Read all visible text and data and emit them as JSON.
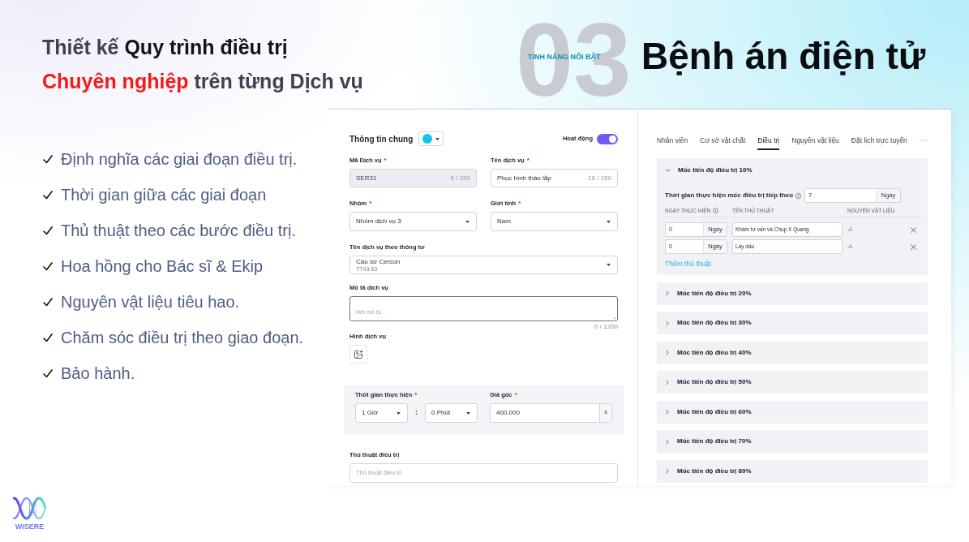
{
  "header": {
    "headline": [
      {
        "parts": [
          {
            "text": "Thiết kế ",
            "kind": "muted"
          },
          {
            "text": "Quy trình điều trị",
            "kind": "strong"
          }
        ]
      },
      {
        "parts": [
          {
            "text": "Chuyên nghiệp",
            "kind": "accent"
          },
          {
            "text": " trên từng Dịch vụ",
            "kind": "muted"
          }
        ]
      }
    ],
    "number": "03",
    "tag": "TÍNH NĂNG NỔI BẬT",
    "title": "Bệnh án điện tử"
  },
  "features": [
    "Định nghĩa các giai đoạn điều trị.",
    "Thời gian giữa các giai đoạn",
    "Thủ thuật theo các bước điều trị.",
    "Hoa hồng cho Bác sĩ & Ekip",
    "Nguyên vật liệu tiêu hao.",
    "Chăm sóc điều trị theo giao đoạn.",
    "Bảo hành."
  ],
  "brand": {
    "name": "WISERE"
  },
  "service_form": {
    "title": "Thông tin chung",
    "color_picker": {
      "color": "#14c4e8"
    },
    "status": {
      "label": "Hoạt động",
      "on": true
    },
    "field_rows": [
      [
        {
          "kind": "text",
          "label": "Mã Dịch vụ",
          "mark": "*",
          "value": "SER31",
          "counter": "5 / 150",
          "disabled": true
        },
        {
          "kind": "text",
          "label": "Tên dịch vụ",
          "mark": "*",
          "value": "Phục hình tháo lắp",
          "counter": "18 / 150",
          "disabled": false
        }
      ],
      [
        {
          "kind": "select",
          "label": "Nhóm",
          "mark": "*",
          "value": "Nhóm dịch vụ 3"
        },
        {
          "kind": "select",
          "label": "Giới tính",
          "mark": "*",
          "value": "Nam"
        }
      ],
      [
        {
          "kind": "select",
          "label": "Tên dịch vụ theo thông tư",
          "value": "Cầu sứ Cercon",
          "detail": "TT43-63"
        }
      ],
      [
        {
          "kind": "textarea",
          "label": "Mô tả dịch vụ",
          "placeholder": "Viết mô tả...",
          "counter": "0 / 1200",
          "focused": true
        }
      ],
      [
        {
          "kind": "image",
          "label": "Hình dịch vụ"
        }
      ]
    ],
    "timing": {
      "label": "Thời gian thực hiện",
      "mark": "*",
      "hours": "1 Giờ",
      "separator": ":",
      "minutes": "0 Phút"
    },
    "price": {
      "label": "Giá gốc",
      "mark": "*",
      "value": "400.000",
      "currency": "₫"
    },
    "procedure": {
      "label": "Thủ thuật điều trị",
      "placeholder": "Thủ thuật điều trị"
    }
  },
  "treatment_panel": {
    "tabs": [
      {
        "label": "Nhân viên",
        "selected": false
      },
      {
        "label": "Cơ sở vật chất",
        "selected": false
      },
      {
        "label": "Điều trị",
        "selected": true
      },
      {
        "label": "Nguyên vật liệu",
        "selected": false
      },
      {
        "label": "Đặt lịch trực tuyến",
        "selected": false
      }
    ],
    "milestones": [
      {
        "title": "Mốc tiến độ điều trị 10%",
        "expanded": true,
        "next_time": {
          "label": "Thời gian thực hiện mốc điều trị tiếp theo",
          "info": true,
          "value": "7",
          "unit": "Ngày"
        },
        "columns": [
          {
            "label": "NGÀY THỰC HIỆN",
            "info": true
          },
          {
            "label": "TÊN THỦ THUẬT",
            "info": false
          },
          {
            "label": "NGUYÊN VẬT LIỆU",
            "info": false
          }
        ],
        "procedures": [
          {
            "day": "0",
            "unit": "Ngày",
            "name": "Khám tư vấn và Chụp X Quang",
            "materials": "-/-"
          },
          {
            "day": "0",
            "unit": "Ngày",
            "name": "Lấy dấu",
            "materials": "-/-"
          }
        ],
        "add_label": "Thêm thủ thuật"
      },
      {
        "title": "Mốc tiến độ điều trị 20%",
        "expanded": false
      },
      {
        "title": "Mốc tiến độ điều trị 30%",
        "expanded": false
      },
      {
        "title": "Mốc tiến độ điều trị 40%",
        "expanded": false
      },
      {
        "title": "Mốc tiến độ điều trị 50%",
        "expanded": false
      },
      {
        "title": "Mốc tiến độ điều trị 60%",
        "expanded": false
      },
      {
        "title": "Mốc tiến độ điều trị 70%",
        "expanded": false
      },
      {
        "title": "Mốc tiến độ điều trị 80%",
        "expanded": false
      }
    ]
  }
}
